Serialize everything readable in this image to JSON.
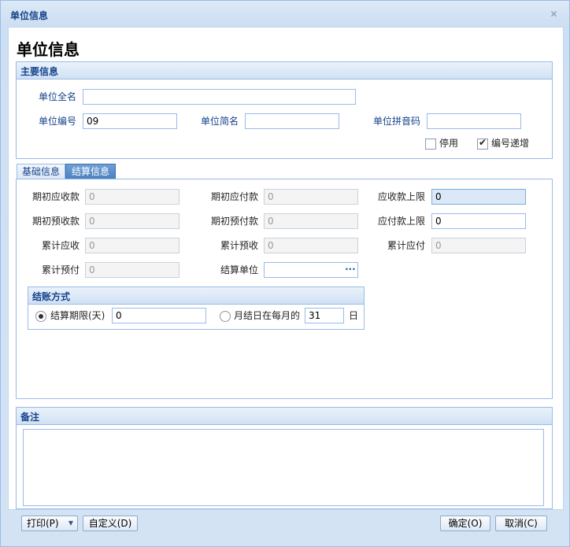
{
  "window": {
    "title": "单位信息"
  },
  "heading": "单位信息",
  "main_panel": {
    "title": "主要信息",
    "fullname_label": "单位全名",
    "fullname_value": "",
    "code_label": "单位编号",
    "code_value": "09",
    "shortname_label": "单位简名",
    "shortname_value": "",
    "pinyin_label": "单位拼音码",
    "pinyin_value": "",
    "disabled_label": "停用",
    "disabled_checked": false,
    "autoinc_label": "编号递增",
    "autoinc_checked": true
  },
  "tabs": [
    {
      "label": "基础信息",
      "active": false
    },
    {
      "label": "结算信息",
      "active": true
    }
  ],
  "settlement": {
    "row1": [
      {
        "label": "期初应收款",
        "value": "0"
      },
      {
        "label": "期初应付款",
        "value": "0"
      },
      {
        "label": "应收款上限",
        "value": "0"
      }
    ],
    "row2": [
      {
        "label": "期初预收款",
        "value": "0"
      },
      {
        "label": "期初预付款",
        "value": "0"
      },
      {
        "label": "应付款上限",
        "value": "0"
      }
    ],
    "row3": [
      {
        "label": "累计应收",
        "value": "0"
      },
      {
        "label": "累计预收",
        "value": "0"
      },
      {
        "label": "累计应付",
        "value": "0"
      }
    ],
    "row4": [
      {
        "label": "累计预付",
        "value": "0"
      },
      {
        "label": "结算单位",
        "value": ""
      }
    ],
    "ellipsis": "···",
    "method": {
      "title": "结账方式",
      "option1_label": "结算期限(天)",
      "option1_value": "0",
      "option1_selected": true,
      "option2_label": "月结日在每月的",
      "option2_value": "31",
      "option2_unit": "日"
    }
  },
  "remarks": {
    "title": "备注",
    "value": ""
  },
  "buttons": {
    "print": "打印(P)",
    "customize": "自定义(D)",
    "ok": "确定(O)",
    "cancel": "取消(C)"
  },
  "colors": {
    "accent": "#15428b",
    "border": "#99bbe8"
  }
}
